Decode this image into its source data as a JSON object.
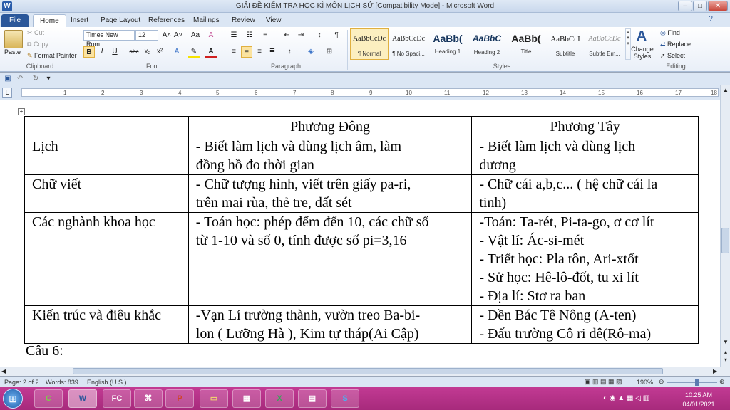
{
  "window": {
    "title": "GIẢI ĐỀ KIỂM TRA HỌC KÌ MÔN LỊCH SỬ [Compatibility Mode] - Microsoft Word",
    "app_icon": "W",
    "controls": [
      "–",
      "□",
      "✕"
    ]
  },
  "tabs": [
    {
      "label": "File"
    },
    {
      "label": "Home"
    },
    {
      "label": "Insert"
    },
    {
      "label": "Page Layout"
    },
    {
      "label": "References"
    },
    {
      "label": "Mailings"
    },
    {
      "label": "Review"
    },
    {
      "label": "View"
    }
  ],
  "ribbon": {
    "clipboard": {
      "paste": "Paste",
      "cut": "Cut",
      "copy": "Copy",
      "format_painter": "Format Painter",
      "label": "Clipboard"
    },
    "font": {
      "name": "Times New Rom",
      "size": "12",
      "label": "Font",
      "bold": "B",
      "italic": "I",
      "underline": "U",
      "strike": "abc",
      "sub": "x₂",
      "sup": "x²",
      "grow": "A˄",
      "shrink": "A˅",
      "case": "Aa",
      "clear": "A"
    },
    "paragraph": {
      "label": "Paragraph",
      "pilcrow": "¶"
    },
    "styles": {
      "label": "Styles",
      "items": [
        {
          "sample": "AaBbCcDc",
          "name": "¶ Normal"
        },
        {
          "sample": "AaBbCcDc",
          "name": "¶ No Spaci..."
        },
        {
          "sample": "AaBb(",
          "name": "Heading 1"
        },
        {
          "sample": "AaBbC",
          "name": "Heading 2"
        },
        {
          "sample": "AaBb(",
          "name": "Title"
        },
        {
          "sample": "AaBbCcI",
          "name": "Subtitle"
        },
        {
          "sample": "AaBbCcDc",
          "name": "Subtle Em..."
        }
      ],
      "change_styles": "Change Styles"
    },
    "editing": {
      "label": "Editing",
      "find": "Find",
      "replace": "Replace",
      "select": "Select"
    }
  },
  "ruler_numbers": [
    "1",
    "2",
    "3",
    "4",
    "5",
    "6",
    "7",
    "8",
    "9",
    "10",
    "11",
    "12",
    "13",
    "14",
    "15",
    "16",
    "17",
    "18"
  ],
  "table": {
    "headers": [
      "",
      "Phương Đông",
      "Phương Tây"
    ],
    "rows": [
      {
        "label": "Lịch",
        "east": [
          "- Biết làm lịch và dùng lịch âm, làm",
          "đồng hồ đo thời gian"
        ],
        "west": [
          "- Biết làm lịch và dùng lịch",
          "dương"
        ]
      },
      {
        "label": "Chữ viết",
        "east": [
          "- Chữ tượng hình, viết trên giấy pa-ri,",
          "trên mai rùa, thẻ tre, đất sét"
        ],
        "west": [
          "- Chữ cái a,b,c... ( hệ chữ cái la",
          "tinh)"
        ]
      },
      {
        "label": "Các nghành khoa học",
        "east": [
          "- Toán học: phép đếm đến 10, các chữ số",
          "từ 1-10 và số 0, tính được số pi=3,16"
        ],
        "west": [
          "-Toán: Ta-rét, Pi-ta-go, ơ cơ lít",
          "- Vật lí: Ác-si-mét",
          "- Triết học: Pla tôn, Ari-xtốt",
          "- Sử học: Hê-lô-đốt, tu xi lít",
          "- Địa lí: Stơ ra ban"
        ]
      },
      {
        "label": "Kiến trúc và điêu khắc",
        "east": [
          "-Vạn Lí trường thành, vườn treo Ba-bi-",
          "lon ( Lưỡng Hà ), Kim tự tháp(Ai Cập)"
        ],
        "west": [
          "- Đền Bác Tê Nông (A-ten)",
          "- Đấu trường Cô ri đê(Rô-ma)"
        ]
      }
    ]
  },
  "after_table": "Câu 6:",
  "status": {
    "page": "Page: 2 of 2",
    "words": "Words: 839",
    "language": "English (U.S.)",
    "zoom": "190%"
  },
  "taskbar": {
    "apps": [
      "⊞",
      "C",
      "W",
      "FC",
      "⌘",
      "P",
      "▭",
      "▦",
      "X",
      "▤",
      "S"
    ],
    "time": "10:25 AM",
    "date": "04/01/2021"
  }
}
